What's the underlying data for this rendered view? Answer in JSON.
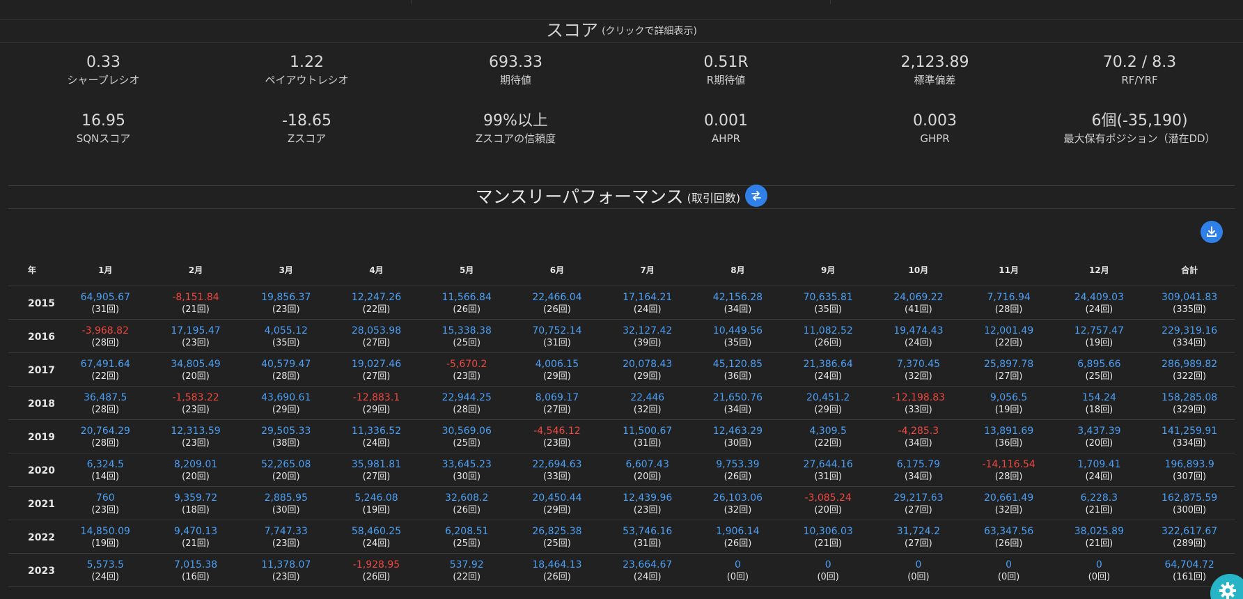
{
  "score": {
    "title": "スコア",
    "hint": "(クリックで詳細表示)",
    "items": [
      {
        "value": "0.33",
        "label": "シャープレシオ"
      },
      {
        "value": "1.22",
        "label": "ペイアウトレシオ"
      },
      {
        "value": "693.33",
        "label": "期待値"
      },
      {
        "value": "0.51R",
        "label": "R期待値"
      },
      {
        "value": "2,123.89",
        "label": "標準偏差"
      },
      {
        "value": "70.2 / 8.3",
        "label": "RF/YRF"
      },
      {
        "value": "16.95",
        "label": "SQNスコア"
      },
      {
        "value": "-18.65",
        "label": "Zスコア"
      },
      {
        "value": "99%以上",
        "label": "Zスコアの信頼度"
      },
      {
        "value": "0.001",
        "label": "AHPR"
      },
      {
        "value": "0.003",
        "label": "GHPR"
      },
      {
        "value": "6個(-35,190)",
        "label": "最大保有ポジション（潜在DD）"
      }
    ]
  },
  "monthly": {
    "title": "マンスリーパフォーマンス",
    "mode": "(取引回数)",
    "swap_icon": "swap-icon",
    "download_icon": "download-icon",
    "headers": [
      "年",
      "1月",
      "2月",
      "3月",
      "4月",
      "5月",
      "6月",
      "7月",
      "8月",
      "9月",
      "10月",
      "11月",
      "12月",
      "合計"
    ],
    "rows": [
      {
        "year": "2015",
        "cells": [
          {
            "v": "64,905.67",
            "c": "(31回)",
            "neg": false
          },
          {
            "v": "-8,151.84",
            "c": "(21回)",
            "neg": true
          },
          {
            "v": "19,856.37",
            "c": "(23回)",
            "neg": false
          },
          {
            "v": "12,247.26",
            "c": "(22回)",
            "neg": false
          },
          {
            "v": "11,566.84",
            "c": "(26回)",
            "neg": false
          },
          {
            "v": "22,466.04",
            "c": "(26回)",
            "neg": false
          },
          {
            "v": "17,164.21",
            "c": "(24回)",
            "neg": false
          },
          {
            "v": "42,156.28",
            "c": "(34回)",
            "neg": false
          },
          {
            "v": "70,635.81",
            "c": "(35回)",
            "neg": false
          },
          {
            "v": "24,069.22",
            "c": "(41回)",
            "neg": false
          },
          {
            "v": "7,716.94",
            "c": "(28回)",
            "neg": false
          },
          {
            "v": "24,409.03",
            "c": "(24回)",
            "neg": false
          },
          {
            "v": "309,041.83",
            "c": "(335回)",
            "neg": false
          }
        ]
      },
      {
        "year": "2016",
        "cells": [
          {
            "v": "-3,968.82",
            "c": "(28回)",
            "neg": true
          },
          {
            "v": "17,195.47",
            "c": "(23回)",
            "neg": false
          },
          {
            "v": "4,055.12",
            "c": "(35回)",
            "neg": false
          },
          {
            "v": "28,053.98",
            "c": "(27回)",
            "neg": false
          },
          {
            "v": "15,338.38",
            "c": "(25回)",
            "neg": false
          },
          {
            "v": "70,752.14",
            "c": "(31回)",
            "neg": false
          },
          {
            "v": "32,127.42",
            "c": "(39回)",
            "neg": false
          },
          {
            "v": "10,449.56",
            "c": "(35回)",
            "neg": false
          },
          {
            "v": "11,082.52",
            "c": "(26回)",
            "neg": false
          },
          {
            "v": "19,474.43",
            "c": "(24回)",
            "neg": false
          },
          {
            "v": "12,001.49",
            "c": "(22回)",
            "neg": false
          },
          {
            "v": "12,757.47",
            "c": "(19回)",
            "neg": false
          },
          {
            "v": "229,319.16",
            "c": "(334回)",
            "neg": false
          }
        ]
      },
      {
        "year": "2017",
        "cells": [
          {
            "v": "67,491.64",
            "c": "(22回)",
            "neg": false
          },
          {
            "v": "34,805.49",
            "c": "(20回)",
            "neg": false
          },
          {
            "v": "40,579.47",
            "c": "(28回)",
            "neg": false
          },
          {
            "v": "19,027.46",
            "c": "(27回)",
            "neg": false
          },
          {
            "v": "-5,670.2",
            "c": "(23回)",
            "neg": true
          },
          {
            "v": "4,006.15",
            "c": "(29回)",
            "neg": false
          },
          {
            "v": "20,078.43",
            "c": "(29回)",
            "neg": false
          },
          {
            "v": "45,120.85",
            "c": "(36回)",
            "neg": false
          },
          {
            "v": "21,386.64",
            "c": "(24回)",
            "neg": false
          },
          {
            "v": "7,370.45",
            "c": "(32回)",
            "neg": false
          },
          {
            "v": "25,897.78",
            "c": "(27回)",
            "neg": false
          },
          {
            "v": "6,895.66",
            "c": "(25回)",
            "neg": false
          },
          {
            "v": "286,989.82",
            "c": "(322回)",
            "neg": false
          }
        ]
      },
      {
        "year": "2018",
        "cells": [
          {
            "v": "36,487.5",
            "c": "(28回)",
            "neg": false
          },
          {
            "v": "-1,583.22",
            "c": "(23回)",
            "neg": true
          },
          {
            "v": "43,690.61",
            "c": "(29回)",
            "neg": false
          },
          {
            "v": "-12,883.1",
            "c": "(29回)",
            "neg": true
          },
          {
            "v": "22,944.25",
            "c": "(28回)",
            "neg": false
          },
          {
            "v": "8,069.17",
            "c": "(27回)",
            "neg": false
          },
          {
            "v": "22,446",
            "c": "(32回)",
            "neg": false
          },
          {
            "v": "21,650.76",
            "c": "(34回)",
            "neg": false
          },
          {
            "v": "20,451.2",
            "c": "(29回)",
            "neg": false
          },
          {
            "v": "-12,198.83",
            "c": "(33回)",
            "neg": true
          },
          {
            "v": "9,056.5",
            "c": "(19回)",
            "neg": false
          },
          {
            "v": "154.24",
            "c": "(18回)",
            "neg": false
          },
          {
            "v": "158,285.08",
            "c": "(329回)",
            "neg": false
          }
        ]
      },
      {
        "year": "2019",
        "cells": [
          {
            "v": "20,764.29",
            "c": "(28回)",
            "neg": false
          },
          {
            "v": "12,313.59",
            "c": "(23回)",
            "neg": false
          },
          {
            "v": "29,505.33",
            "c": "(38回)",
            "neg": false
          },
          {
            "v": "11,336.52",
            "c": "(24回)",
            "neg": false
          },
          {
            "v": "30,569.06",
            "c": "(25回)",
            "neg": false
          },
          {
            "v": "-4,546.12",
            "c": "(23回)",
            "neg": true
          },
          {
            "v": "11,500.67",
            "c": "(31回)",
            "neg": false
          },
          {
            "v": "12,463.29",
            "c": "(30回)",
            "neg": false
          },
          {
            "v": "4,309.5",
            "c": "(22回)",
            "neg": false
          },
          {
            "v": "-4,285.3",
            "c": "(34回)",
            "neg": true
          },
          {
            "v": "13,891.69",
            "c": "(36回)",
            "neg": false
          },
          {
            "v": "3,437.39",
            "c": "(20回)",
            "neg": false
          },
          {
            "v": "141,259.91",
            "c": "(334回)",
            "neg": false
          }
        ]
      },
      {
        "year": "2020",
        "cells": [
          {
            "v": "6,324.5",
            "c": "(14回)",
            "neg": false
          },
          {
            "v": "8,209.01",
            "c": "(20回)",
            "neg": false
          },
          {
            "v": "52,265.08",
            "c": "(20回)",
            "neg": false
          },
          {
            "v": "35,981.81",
            "c": "(27回)",
            "neg": false
          },
          {
            "v": "33,645.23",
            "c": "(30回)",
            "neg": false
          },
          {
            "v": "22,694.63",
            "c": "(33回)",
            "neg": false
          },
          {
            "v": "6,607.43",
            "c": "(20回)",
            "neg": false
          },
          {
            "v": "9,753.39",
            "c": "(26回)",
            "neg": false
          },
          {
            "v": "27,644.16",
            "c": "(31回)",
            "neg": false
          },
          {
            "v": "6,175.79",
            "c": "(34回)",
            "neg": false
          },
          {
            "v": "-14,116.54",
            "c": "(28回)",
            "neg": true
          },
          {
            "v": "1,709.41",
            "c": "(24回)",
            "neg": false
          },
          {
            "v": "196,893.9",
            "c": "(307回)",
            "neg": false
          }
        ]
      },
      {
        "year": "2021",
        "cells": [
          {
            "v": "760",
            "c": "(23回)",
            "neg": false
          },
          {
            "v": "9,359.72",
            "c": "(18回)",
            "neg": false
          },
          {
            "v": "2,885.95",
            "c": "(30回)",
            "neg": false
          },
          {
            "v": "5,246.08",
            "c": "(19回)",
            "neg": false
          },
          {
            "v": "32,608.2",
            "c": "(26回)",
            "neg": false
          },
          {
            "v": "20,450.44",
            "c": "(29回)",
            "neg": false
          },
          {
            "v": "12,439.96",
            "c": "(23回)",
            "neg": false
          },
          {
            "v": "26,103.06",
            "c": "(32回)",
            "neg": false
          },
          {
            "v": "-3,085.24",
            "c": "(20回)",
            "neg": true
          },
          {
            "v": "29,217.63",
            "c": "(27回)",
            "neg": false
          },
          {
            "v": "20,661.49",
            "c": "(32回)",
            "neg": false
          },
          {
            "v": "6,228.3",
            "c": "(21回)",
            "neg": false
          },
          {
            "v": "162,875.59",
            "c": "(300回)",
            "neg": false
          }
        ]
      },
      {
        "year": "2022",
        "cells": [
          {
            "v": "14,850.09",
            "c": "(19回)",
            "neg": false
          },
          {
            "v": "9,470.13",
            "c": "(21回)",
            "neg": false
          },
          {
            "v": "7,747.33",
            "c": "(23回)",
            "neg": false
          },
          {
            "v": "58,460.25",
            "c": "(24回)",
            "neg": false
          },
          {
            "v": "6,208.51",
            "c": "(25回)",
            "neg": false
          },
          {
            "v": "26,825.38",
            "c": "(25回)",
            "neg": false
          },
          {
            "v": "53,746.16",
            "c": "(31回)",
            "neg": false
          },
          {
            "v": "1,906.14",
            "c": "(26回)",
            "neg": false
          },
          {
            "v": "10,306.03",
            "c": "(21回)",
            "neg": false
          },
          {
            "v": "31,724.2",
            "c": "(27回)",
            "neg": false
          },
          {
            "v": "63,347.56",
            "c": "(26回)",
            "neg": false
          },
          {
            "v": "38,025.89",
            "c": "(21回)",
            "neg": false
          },
          {
            "v": "322,617.67",
            "c": "(289回)",
            "neg": false
          }
        ]
      },
      {
        "year": "2023",
        "cells": [
          {
            "v": "5,573.5",
            "c": "(24回)",
            "neg": false
          },
          {
            "v": "7,015.38",
            "c": "(16回)",
            "neg": false
          },
          {
            "v": "11,378.07",
            "c": "(23回)",
            "neg": false
          },
          {
            "v": "-1,928.95",
            "c": "(26回)",
            "neg": true
          },
          {
            "v": "537.92",
            "c": "(22回)",
            "neg": false
          },
          {
            "v": "18,464.13",
            "c": "(26回)",
            "neg": false
          },
          {
            "v": "23,664.67",
            "c": "(24回)",
            "neg": false
          },
          {
            "v": "0",
            "c": "(0回)",
            "neg": false
          },
          {
            "v": "0",
            "c": "(0回)",
            "neg": false
          },
          {
            "v": "0",
            "c": "(0回)",
            "neg": false
          },
          {
            "v": "0",
            "c": "(0回)",
            "neg": false
          },
          {
            "v": "0",
            "c": "(0回)",
            "neg": false
          },
          {
            "v": "64,704.72",
            "c": "(161回)",
            "neg": false
          }
        ]
      }
    ]
  },
  "fab": {
    "icon": "gear-icon"
  },
  "colors": {
    "background": "#212121",
    "positive": "#4a9ff5",
    "negative": "#f0473e",
    "button": "#2f80e8",
    "fab": "#27b4c6"
  }
}
